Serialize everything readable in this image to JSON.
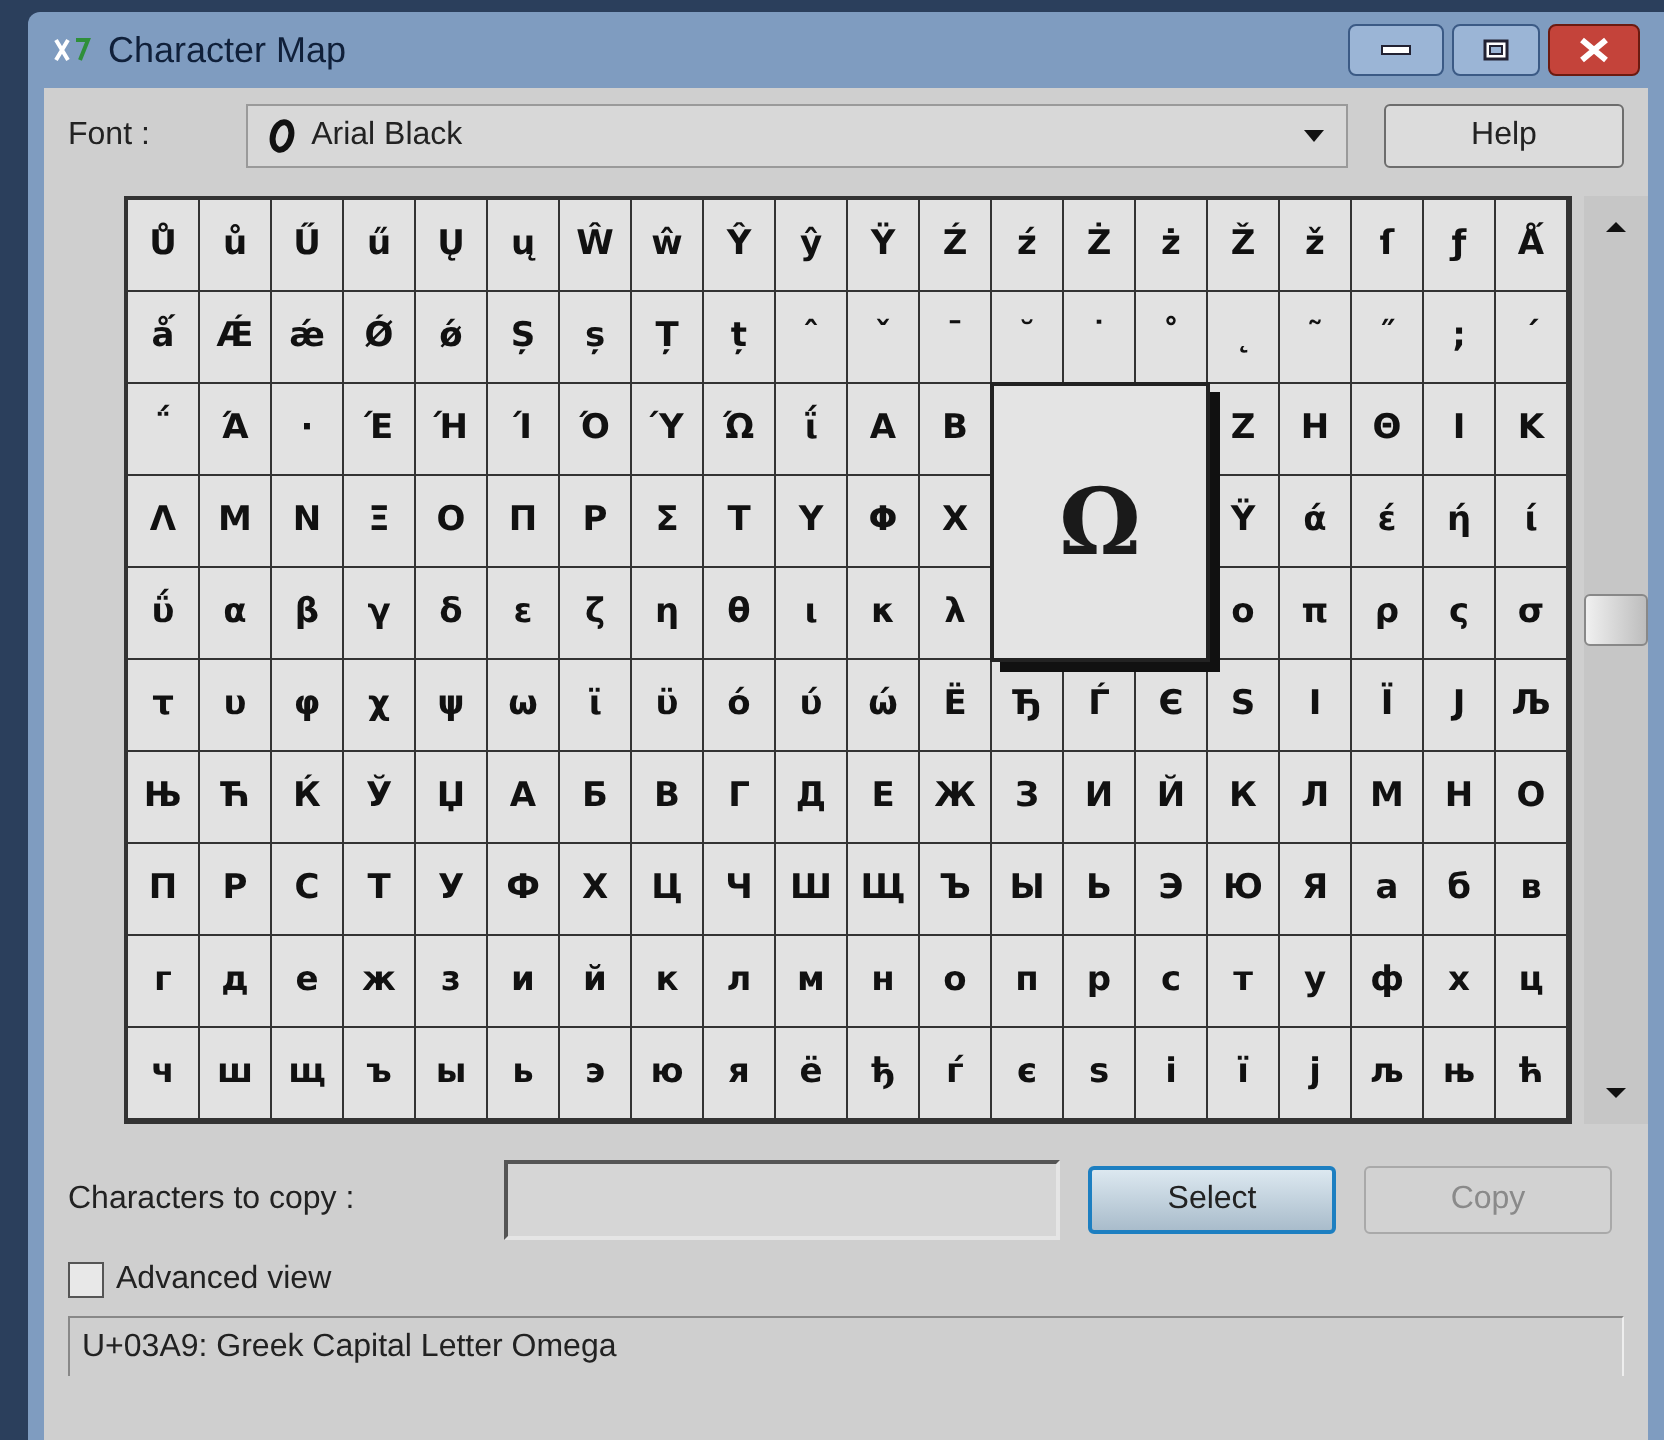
{
  "window": {
    "title": "Character Map"
  },
  "font": {
    "label": "Font :",
    "value": "Arial Black"
  },
  "help_button": "Help",
  "grid": {
    "rows": [
      [
        "Ů",
        "ů",
        "Ű",
        "ű",
        "Ų",
        "ų",
        "Ŵ",
        "ŵ",
        "Ŷ",
        "ŷ",
        "Ÿ",
        "Ź",
        "ź",
        "Ż",
        "ż",
        "Ž",
        "ž",
        "ſ",
        "ƒ",
        "Ǻ"
      ],
      [
        "ǻ",
        "Ǽ",
        "ǽ",
        "Ǿ",
        "ǿ",
        "Ș",
        "ș",
        "Ț",
        "ț",
        "ˆ",
        "ˇ",
        "ˉ",
        "˘",
        "˙",
        "˚",
        "˛",
        "˜",
        "˝",
        ";",
        "΄"
      ],
      [
        "΅",
        "Ά",
        "·",
        "Έ",
        "Ή",
        "Ί",
        "Ό",
        "Ύ",
        "Ώ",
        "ΐ",
        "Α",
        "Β",
        null,
        null,
        null,
        "Ζ",
        "Η",
        "Θ",
        "Ι",
        "Κ"
      ],
      [
        "Λ",
        "Μ",
        "Ν",
        "Ξ",
        "Ο",
        "Π",
        "Ρ",
        "Σ",
        "Τ",
        "Υ",
        "Φ",
        "Χ",
        null,
        null,
        null,
        "Ϋ",
        "ά",
        "έ",
        "ή",
        "ί"
      ],
      [
        "ΰ",
        "α",
        "β",
        "γ",
        "δ",
        "ε",
        "ζ",
        "η",
        "θ",
        "ι",
        "κ",
        "λ",
        null,
        null,
        null,
        "ο",
        "π",
        "ρ",
        "ς",
        "σ"
      ],
      [
        "τ",
        "υ",
        "φ",
        "χ",
        "ψ",
        "ω",
        "ϊ",
        "ϋ",
        "ό",
        "ύ",
        "ώ",
        "Ё",
        "Ђ",
        "Ѓ",
        "Є",
        "Ѕ",
        "І",
        "Ї",
        "Ј",
        "Љ"
      ],
      [
        "Њ",
        "Ћ",
        "Ќ",
        "Ў",
        "Џ",
        "А",
        "Б",
        "В",
        "Г",
        "Д",
        "Е",
        "Ж",
        "З",
        "И",
        "Й",
        "К",
        "Л",
        "М",
        "Н",
        "О"
      ],
      [
        "П",
        "Р",
        "С",
        "Т",
        "У",
        "Ф",
        "Х",
        "Ц",
        "Ч",
        "Ш",
        "Щ",
        "Ъ",
        "Ы",
        "Ь",
        "Э",
        "Ю",
        "Я",
        "а",
        "б",
        "в"
      ],
      [
        "г",
        "д",
        "е",
        "ж",
        "з",
        "и",
        "й",
        "к",
        "л",
        "м",
        "н",
        "о",
        "п",
        "р",
        "с",
        "т",
        "у",
        "ф",
        "х",
        "ц"
      ],
      [
        "ч",
        "ш",
        "щ",
        "ъ",
        "ы",
        "ь",
        "э",
        "ю",
        "я",
        "ё",
        "ђ",
        "ѓ",
        "є",
        "ѕ",
        "і",
        "ї",
        "ј",
        "љ",
        "њ",
        "ћ"
      ]
    ]
  },
  "magnified": "Ω",
  "copy": {
    "label": "Characters to copy :",
    "select_button": "Select",
    "copy_button": {
      "label": "Copy",
      "disabled": true
    }
  },
  "advanced_view": {
    "label": "Advanced view",
    "checked": false
  },
  "status_bar": "U+03A9: Greek Capital Letter Omega"
}
